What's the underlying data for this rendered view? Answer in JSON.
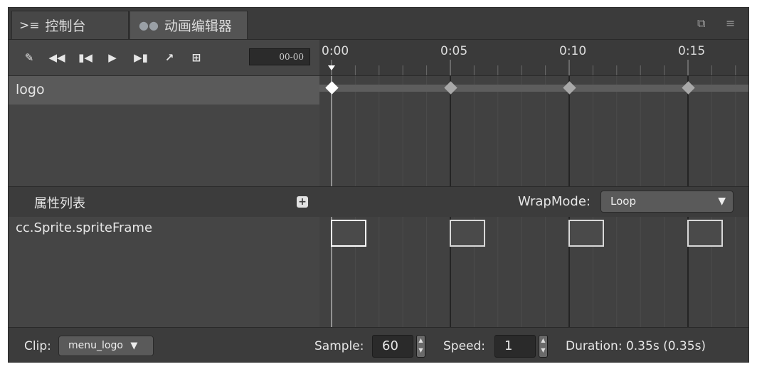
{
  "tabs": [
    {
      "label": "控制台",
      "icon": "console-icon"
    },
    {
      "label": "动画编辑器",
      "icon": "animation-editor-icon"
    }
  ],
  "toolbar": {
    "buttons": [
      "edit-icon",
      "jump-to-start-icon",
      "prev-frame-icon",
      "play-icon",
      "next-frame-icon",
      "open-external-icon",
      "add-event-icon"
    ],
    "frame_value": "00-00"
  },
  "timeline": {
    "ticks": [
      "0:00",
      "0:05",
      "0:10",
      "0:15"
    ],
    "ticks_frames": [
      0,
      5,
      10,
      15
    ],
    "current_frame": 0
  },
  "nodes": [
    {
      "name": "logo",
      "keyframes": [
        0,
        5,
        10,
        15
      ],
      "selected_keyframe": 0
    }
  ],
  "properties": {
    "title": "属性列表",
    "wrapmode_label": "WrapMode:",
    "wrapmode_value": "Loop",
    "rows": [
      {
        "name": "cc.Sprite.spriteFrame",
        "keyframes": [
          0,
          5,
          10,
          15
        ]
      }
    ]
  },
  "footer": {
    "clip_label": "Clip:",
    "clip_value": "menu_logo",
    "sample_label": "Sample:",
    "sample_value": "60",
    "speed_label": "Speed:",
    "speed_value": "1",
    "duration_text": "Duration: 0.35s (0.35s)"
  },
  "colors": {
    "panel": "#4a4a4a",
    "selected_row": "#5a5a5a",
    "playhead": "#ffffff"
  }
}
